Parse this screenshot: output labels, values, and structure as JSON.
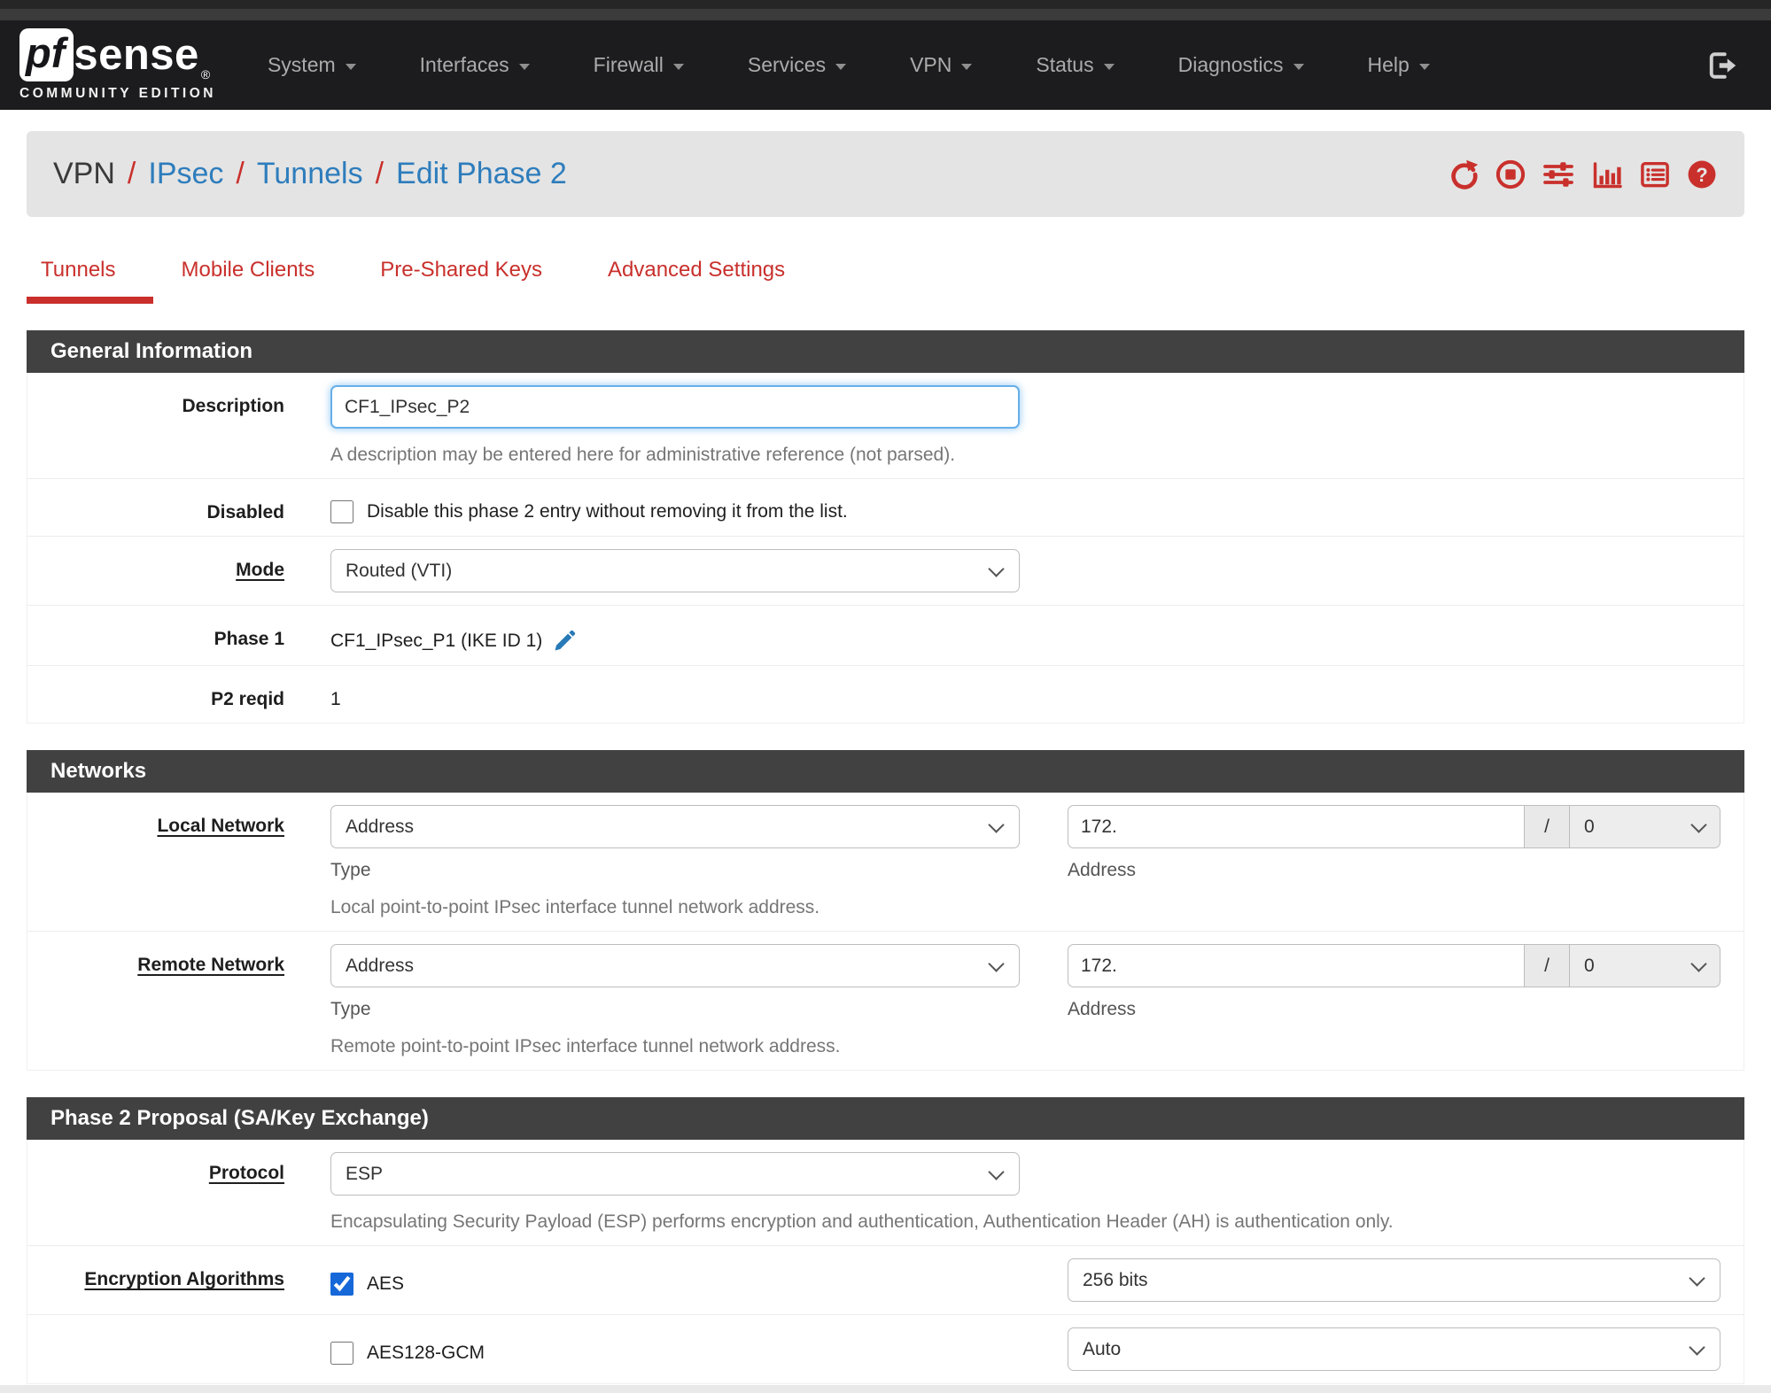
{
  "navbar": {
    "brand_pf": "pf",
    "brand_sense": "sense",
    "brand_trademark": "®",
    "brand_sub": "COMMUNITY EDITION",
    "items": [
      {
        "label": "System"
      },
      {
        "label": "Interfaces"
      },
      {
        "label": "Firewall"
      },
      {
        "label": "Services"
      },
      {
        "label": "VPN"
      },
      {
        "label": "Status"
      },
      {
        "label": "Diagnostics"
      },
      {
        "label": "Help"
      }
    ]
  },
  "breadcrumb": {
    "current": "VPN",
    "sep": "/",
    "links": [
      {
        "label": "IPsec"
      },
      {
        "label": "Tunnels"
      },
      {
        "label": "Edit Phase 2"
      }
    ],
    "action_icons": [
      "restart-icon",
      "stop-icon",
      "related-settings-icon",
      "status-graph-icon",
      "log-icon",
      "help-icon"
    ]
  },
  "tabs": [
    {
      "label": "Tunnels",
      "active": true
    },
    {
      "label": "Mobile Clients",
      "active": false
    },
    {
      "label": "Pre-Shared Keys",
      "active": false
    },
    {
      "label": "Advanced Settings",
      "active": false
    }
  ],
  "general": {
    "title": "General Information",
    "description": {
      "label": "Description",
      "value": "CF1_IPsec_P2",
      "help": "A description may be entered here for administrative reference (not parsed)."
    },
    "disabled": {
      "label": "Disabled",
      "checkbox_label": "Disable this phase 2 entry without removing it from the list.",
      "checked": false
    },
    "mode": {
      "label": "Mode",
      "value": "Routed (VTI)"
    },
    "phase1": {
      "label": "Phase 1",
      "value": "CF1_IPsec_P1 (IKE ID 1)"
    },
    "p2reqid": {
      "label": "P2 reqid",
      "value": "1"
    }
  },
  "networks": {
    "title": "Networks",
    "local": {
      "label": "Local Network",
      "type_value": "Address",
      "type_caption": "Type",
      "address_value": "172.",
      "address_caption": "Address",
      "separator": "/",
      "prefix_value": "0",
      "help": "Local point-to-point IPsec interface tunnel network address."
    },
    "remote": {
      "label": "Remote Network",
      "type_value": "Address",
      "type_caption": "Type",
      "address_value": "172.",
      "address_caption": "Address",
      "separator": "/",
      "prefix_value": "0",
      "help": "Remote point-to-point IPsec interface tunnel network address."
    }
  },
  "proposal": {
    "title": "Phase 2 Proposal (SA/Key Exchange)",
    "protocol": {
      "label": "Protocol",
      "value": "ESP",
      "help": "Encapsulating Security Payload (ESP) performs encryption and authentication, Authentication Header (AH) is authentication only."
    },
    "encryption": {
      "label": "Encryption Algorithms",
      "algorithms": [
        {
          "name": "AES",
          "checked": true,
          "keylen": "256 bits"
        },
        {
          "name": "AES128-GCM",
          "checked": false,
          "keylen": "Auto"
        }
      ]
    }
  },
  "colors": {
    "brand_red": "#c9302c",
    "link_blue": "#2e7dbc",
    "navbar_bg": "#1c1c1e",
    "section_header_bg": "#414141",
    "focus_blue": "#66afe9",
    "checkbox_blue": "#1668d9"
  }
}
